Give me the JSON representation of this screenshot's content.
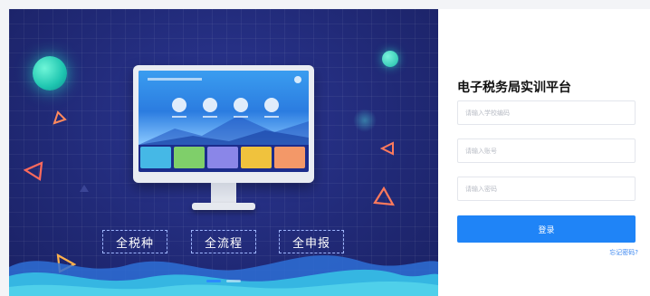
{
  "banner": {
    "tags": [
      "全税种",
      "全流程",
      "全申报"
    ]
  },
  "login": {
    "title": "电子税务局实训平台",
    "school_placeholder": "请输入学校编码",
    "account_placeholder": "请输入账号",
    "password_placeholder": "请输入密码",
    "submit_label": "登录",
    "forgot_label": "忘记密码?"
  },
  "colors": {
    "banner_bg": "#212a78",
    "primary_button": "#1f84f7",
    "link": "#3a86f0"
  }
}
